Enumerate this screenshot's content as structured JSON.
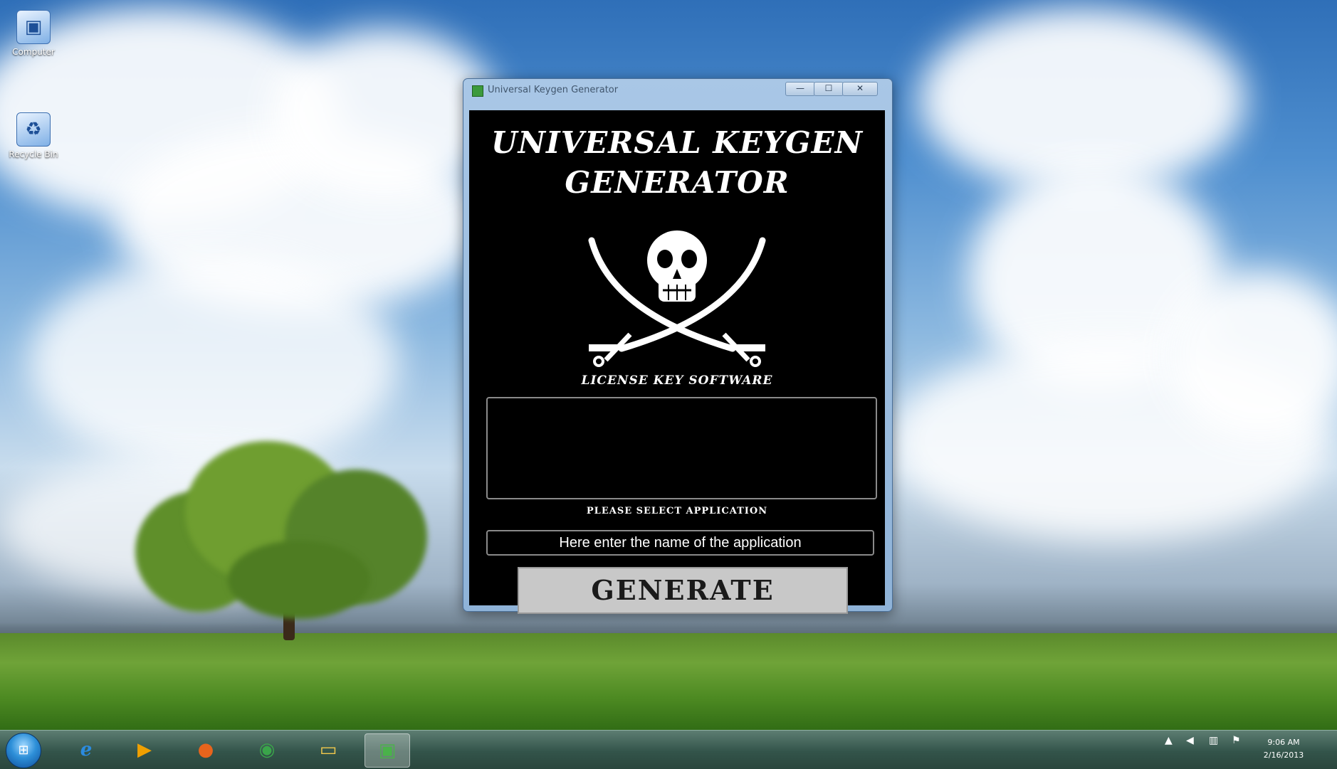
{
  "desktop": {
    "icons": [
      {
        "label": "Computer",
        "icon": "computer-icon"
      },
      {
        "label": "Recycle Bin",
        "icon": "recycle-bin-icon"
      }
    ]
  },
  "window": {
    "title": "Universal Keygen Generator",
    "controls": {
      "minimize": "—",
      "maximize": "☐",
      "close": "✕"
    }
  },
  "app": {
    "title_line1": "UNIVERSAL KEYGEN",
    "title_line2": "GENERATOR",
    "logo": "skull-crossed-swords",
    "subtitle": "LICENSE KEY SOFTWARE",
    "key_output": "",
    "select_label": "PLEASE SELECT APPLICATION",
    "app_name_value": "Here enter the name of the application",
    "generate_label": "GENERATE"
  },
  "taskbar": {
    "start": "start-orb",
    "items": [
      {
        "icon": "internet-explorer-icon",
        "glyph": "e",
        "color": "#2b8be0"
      },
      {
        "icon": "media-player-icon",
        "glyph": "▶",
        "color": "#f0a000"
      },
      {
        "icon": "firefox-icon",
        "glyph": "●",
        "color": "#e8641c"
      },
      {
        "icon": "chrome-icon",
        "glyph": "◉",
        "color": "#3aa54a"
      },
      {
        "icon": "file-explorer-icon",
        "glyph": "▭",
        "color": "#f2c94c"
      },
      {
        "icon": "keygen-app-icon",
        "glyph": "▣",
        "color": "#4ab24a"
      }
    ],
    "clock_time": "9:06 AM",
    "clock_date": "2/16/2013"
  }
}
